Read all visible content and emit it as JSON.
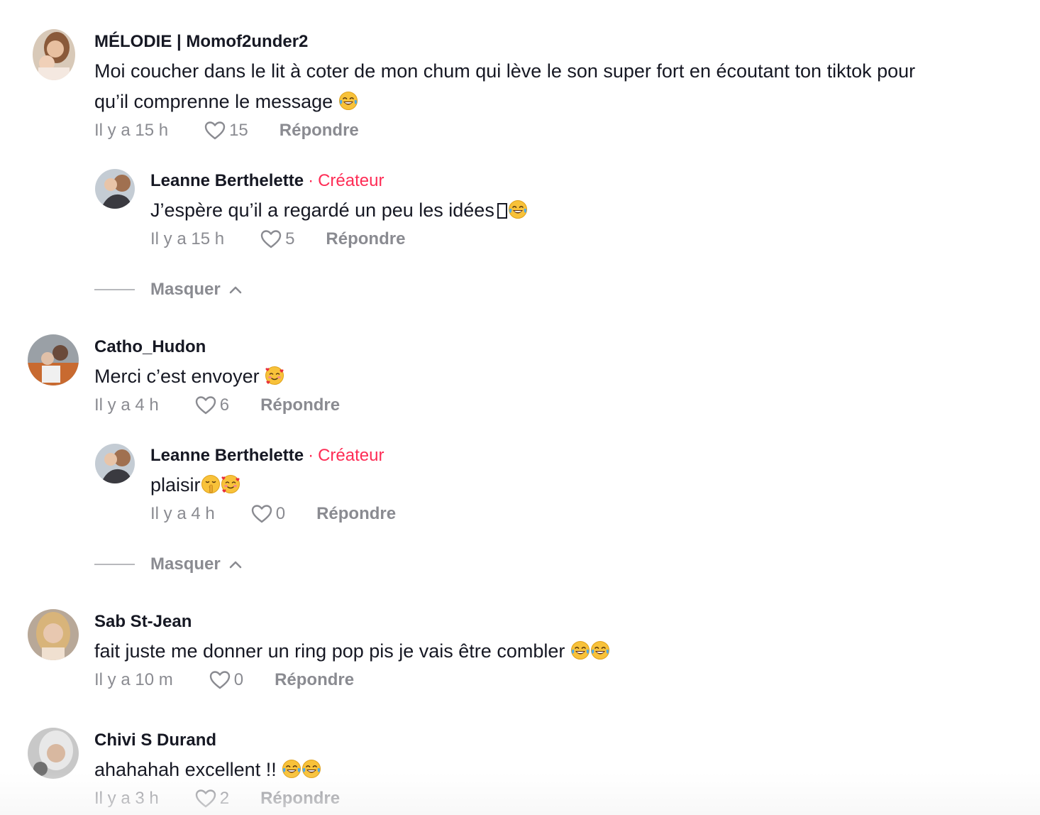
{
  "comments": [
    {
      "author": "MÉLODIE | Momof2under2",
      "text_line1": "Moi coucher dans le lit à coter de mon chum qui lève le son super fort en écoutant ton tiktok pour",
      "text_line2": "qu’il comprenne le message",
      "time": "Il y a 15 h",
      "likes": "15",
      "reply_label": "Répondre",
      "reply": {
        "author": "Leanne Berthelette",
        "creator_dot": "·",
        "creator_label": "Créateur",
        "text": "J’espère qu’il a regardé un peu les idées",
        "time": "Il y a 15 h",
        "likes": "5",
        "reply_label": "Répondre"
      },
      "hide_label": "Masquer"
    },
    {
      "author": "Catho_Hudon",
      "text": "Merci c’est envoyer",
      "time": "Il y a 4 h",
      "likes": "6",
      "reply_label": "Répondre",
      "reply": {
        "author": "Leanne Berthelette",
        "creator_dot": "·",
        "creator_label": "Créateur",
        "text": "plaisir",
        "time": "Il y a 4 h",
        "likes": "0",
        "reply_label": "Répondre"
      },
      "hide_label": "Masquer"
    },
    {
      "author": "Sab St-Jean",
      "text": "fait juste me donner un ring pop pis je vais être combler",
      "time": "Il y a 10 m",
      "likes": "0",
      "reply_label": "Répondre"
    },
    {
      "author": "Chivi S Durand",
      "text": "ahahahah excellent !!",
      "time": "Il y a 3 h",
      "likes": "2",
      "reply_label": "Répondre"
    }
  ],
  "colors": {
    "text": "#161823",
    "muted": "#8a8b91",
    "creator": "#fe2c55"
  },
  "icons": {
    "like": "heart-outline-icon",
    "collapse": "chevron-up-icon",
    "laugh": "tears-of-joy-emoji",
    "love": "smiling-face-with-hearts-emoji",
    "shush": "shushing-face-emoji"
  }
}
